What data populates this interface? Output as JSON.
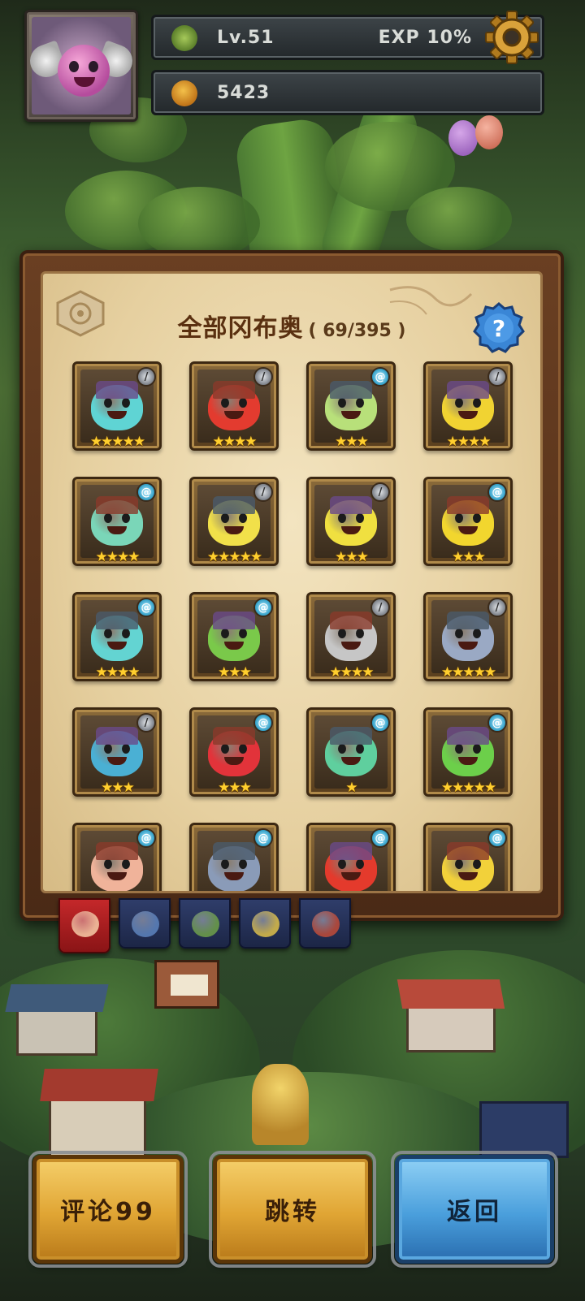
{
  "hud": {
    "level": "Lv.51",
    "exp": "EXP 10%",
    "coins": "5423",
    "icons": {
      "level": "clover-icon",
      "coins": "fruit-icon",
      "settings": "gear-icon"
    }
  },
  "panel": {
    "title": "全部冈布奥",
    "count": "( 69/395 )",
    "help_icon": "question-icon"
  },
  "monsters": [
    {
      "color": "#5fd4d4",
      "badge": "sword",
      "stars": "★★★★★"
    },
    {
      "color": "#e33b2f",
      "badge": "sword",
      "stars": "★★★★"
    },
    {
      "color": "#b8e07a",
      "badge": "magic",
      "stars": "★★★"
    },
    {
      "color": "#f1d332",
      "badge": "sword",
      "stars": "★★★★"
    },
    {
      "color": "#7ad6b8",
      "badge": "magic",
      "stars": "★★★★"
    },
    {
      "color": "#f1e04a",
      "badge": "sword",
      "stars": "★★★★★"
    },
    {
      "color": "#f0e040",
      "badge": "sword",
      "stars": "★★★"
    },
    {
      "color": "#f2d62e",
      "badge": "magic",
      "stars": "★★★"
    },
    {
      "color": "#63d4d2",
      "badge": "magic",
      "stars": "★★★★"
    },
    {
      "color": "#7ac94a",
      "badge": "magic",
      "stars": "★★★"
    },
    {
      "color": "#c6c6c6",
      "badge": "sword",
      "stars": "★★★★"
    },
    {
      "color": "#9aa9c4",
      "badge": "sword",
      "stars": "★★★★★"
    },
    {
      "color": "#4ab0d4",
      "badge": "sword",
      "stars": "★★★"
    },
    {
      "color": "#e2333a",
      "badge": "magic",
      "stars": "★★★"
    },
    {
      "color": "#5fcf9e",
      "badge": "magic",
      "stars": "★"
    },
    {
      "color": "#6ccf4a",
      "badge": "magic",
      "stars": "★★★★★"
    },
    {
      "color": "#f0b39a",
      "badge": "magic",
      "stars": ""
    },
    {
      "color": "#8a9bb8",
      "badge": "magic",
      "stars": ""
    },
    {
      "color": "#e43a2c",
      "badge": "magic",
      "stars": ""
    },
    {
      "color": "#f2d13a",
      "badge": "magic",
      "stars": ""
    }
  ],
  "tabs": [
    {
      "name": "tab-all",
      "color": "#f2c2a0"
    },
    {
      "name": "tab-blue",
      "color": "#5a7fb8"
    },
    {
      "name": "tab-green",
      "color": "#6a9a4a"
    },
    {
      "name": "tab-yellow",
      "color": "#d4b84a"
    },
    {
      "name": "tab-red",
      "color": "#b84a3a"
    }
  ],
  "buttons": {
    "comment": "评论99",
    "jump": "跳转",
    "back": "返回"
  }
}
